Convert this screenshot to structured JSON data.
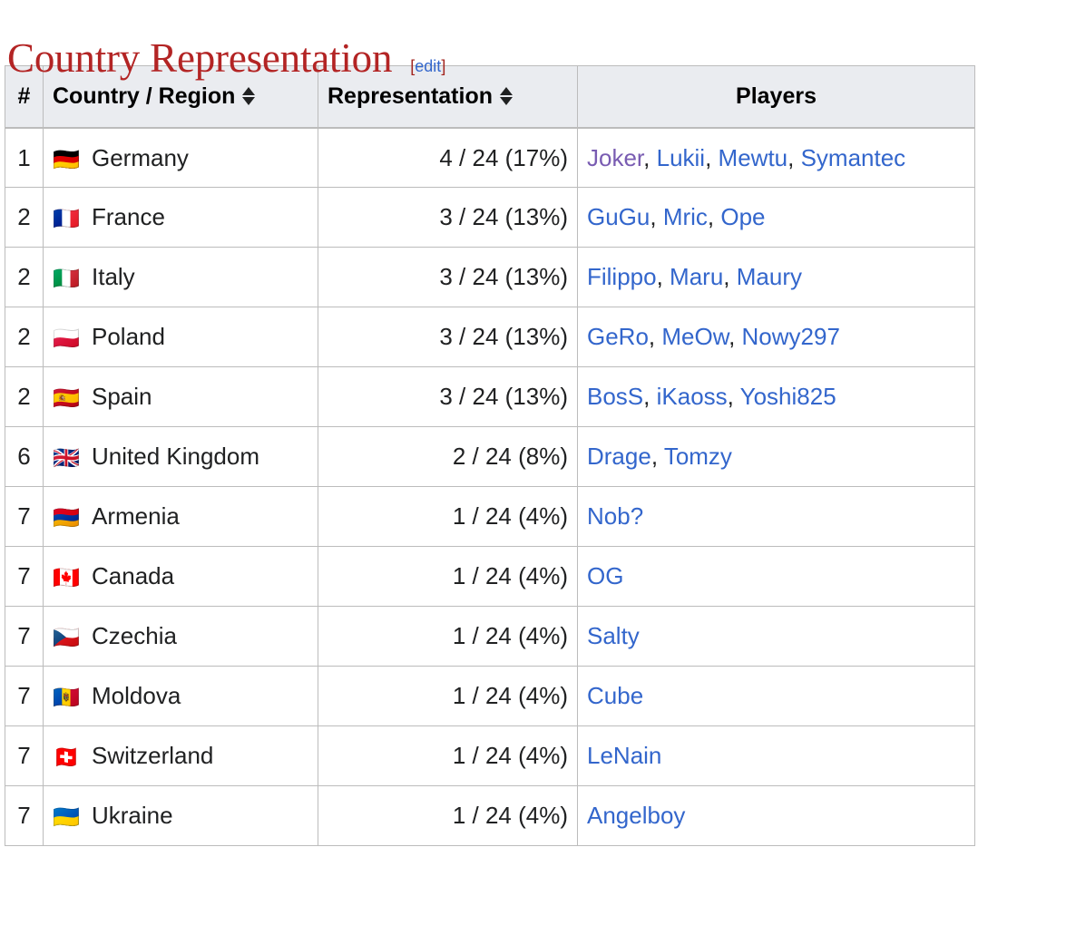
{
  "heading": {
    "title": "Country Representation",
    "edit_open_bracket": "[",
    "edit_label": "edit",
    "edit_close_bracket": "]"
  },
  "colors": {
    "title": "#b32424",
    "link": "#3366cc",
    "visited_link": "#795cb2",
    "header_bg": "#eaecf0",
    "border": "#bcbcbc",
    "text": "#202122"
  },
  "table": {
    "headers": {
      "rank": "#",
      "country": "Country / Region",
      "representation": "Representation",
      "players": "Players"
    },
    "sortable": [
      "country",
      "representation"
    ],
    "sort_icon": "sort-both-arrows",
    "rows": [
      {
        "rank": "1",
        "flag": "🇩🇪",
        "country": "Germany",
        "representation": "4 / 24 (17%)",
        "count": 4,
        "total": 24,
        "percent": 17,
        "players": [
          {
            "name": "Joker",
            "visited": true
          },
          {
            "name": "Lukii",
            "visited": false
          },
          {
            "name": "Mewtu",
            "visited": false
          },
          {
            "name": "Symantec",
            "visited": false
          }
        ]
      },
      {
        "rank": "2",
        "flag": "🇫🇷",
        "country": "France",
        "representation": "3 / 24 (13%)",
        "count": 3,
        "total": 24,
        "percent": 13,
        "players": [
          {
            "name": "GuGu",
            "visited": false
          },
          {
            "name": "Mric",
            "visited": false
          },
          {
            "name": "Ope",
            "visited": false
          }
        ]
      },
      {
        "rank": "2",
        "flag": "🇮🇹",
        "country": "Italy",
        "representation": "3 / 24 (13%)",
        "count": 3,
        "total": 24,
        "percent": 13,
        "players": [
          {
            "name": "Filippo",
            "visited": false
          },
          {
            "name": "Maru",
            "visited": false
          },
          {
            "name": "Maury",
            "visited": false
          }
        ]
      },
      {
        "rank": "2",
        "flag": "🇵🇱",
        "country": "Poland",
        "representation": "3 / 24 (13%)",
        "count": 3,
        "total": 24,
        "percent": 13,
        "players": [
          {
            "name": "GeRo",
            "visited": false
          },
          {
            "name": "MeOw",
            "visited": false
          },
          {
            "name": "Nowy297",
            "visited": false
          }
        ]
      },
      {
        "rank": "2",
        "flag": "🇪🇸",
        "country": "Spain",
        "representation": "3 / 24 (13%)",
        "count": 3,
        "total": 24,
        "percent": 13,
        "players": [
          {
            "name": "BosS",
            "visited": false
          },
          {
            "name": "iKaoss",
            "visited": false
          },
          {
            "name": "Yoshi825",
            "visited": false
          }
        ]
      },
      {
        "rank": "6",
        "flag": "🇬🇧",
        "country": "United Kingdom",
        "representation": "2 / 24 (8%)",
        "count": 2,
        "total": 24,
        "percent": 8,
        "players": [
          {
            "name": "Drage",
            "visited": false
          },
          {
            "name": "Tomzy",
            "visited": false
          }
        ]
      },
      {
        "rank": "7",
        "flag": "🇦🇲",
        "country": "Armenia",
        "representation": "1 / 24 (4%)",
        "count": 1,
        "total": 24,
        "percent": 4,
        "players": [
          {
            "name": "Nob?",
            "visited": false
          }
        ]
      },
      {
        "rank": "7",
        "flag": "🇨🇦",
        "country": "Canada",
        "representation": "1 / 24 (4%)",
        "count": 1,
        "total": 24,
        "percent": 4,
        "players": [
          {
            "name": "OG",
            "visited": false
          }
        ]
      },
      {
        "rank": "7",
        "flag": "🇨🇿",
        "country": "Czechia",
        "representation": "1 / 24 (4%)",
        "count": 1,
        "total": 24,
        "percent": 4,
        "players": [
          {
            "name": "Salty",
            "visited": false
          }
        ]
      },
      {
        "rank": "7",
        "flag": "🇲🇩",
        "country": "Moldova",
        "representation": "1 / 24 (4%)",
        "count": 1,
        "total": 24,
        "percent": 4,
        "players": [
          {
            "name": "Cube",
            "visited": false
          }
        ]
      },
      {
        "rank": "7",
        "flag": "🇨🇭",
        "country": "Switzerland",
        "representation": "1 / 24 (4%)",
        "count": 1,
        "total": 24,
        "percent": 4,
        "players": [
          {
            "name": "LeNain",
            "visited": false
          }
        ]
      },
      {
        "rank": "7",
        "flag": "🇺🇦",
        "country": "Ukraine",
        "representation": "1 / 24 (4%)",
        "count": 1,
        "total": 24,
        "percent": 4,
        "players": [
          {
            "name": "Angelboy",
            "visited": false
          }
        ]
      }
    ]
  }
}
